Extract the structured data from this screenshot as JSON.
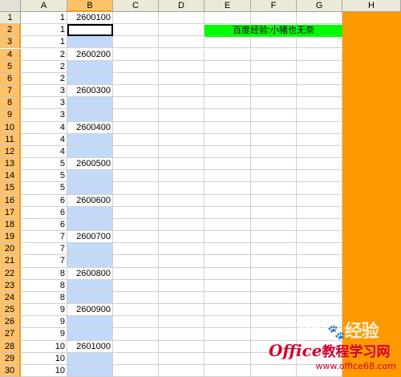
{
  "columns": [
    "A",
    "B",
    "C",
    "D",
    "E",
    "F",
    "G",
    "H"
  ],
  "selected_column": "B",
  "rows": [
    {
      "num": "1",
      "a": "1",
      "b": "2600100"
    },
    {
      "num": "2",
      "a": "1",
      "b": ""
    },
    {
      "num": "3",
      "a": "1",
      "b": ""
    },
    {
      "num": "4",
      "a": "2",
      "b": "2600200"
    },
    {
      "num": "5",
      "a": "2",
      "b": ""
    },
    {
      "num": "6",
      "a": "2",
      "b": ""
    },
    {
      "num": "7",
      "a": "3",
      "b": "2600300"
    },
    {
      "num": "8",
      "a": "3",
      "b": ""
    },
    {
      "num": "9",
      "a": "3",
      "b": ""
    },
    {
      "num": "10",
      "a": "4",
      "b": "2600400"
    },
    {
      "num": "11",
      "a": "4",
      "b": ""
    },
    {
      "num": "12",
      "a": "4",
      "b": ""
    },
    {
      "num": "13",
      "a": "5",
      "b": "2600500"
    },
    {
      "num": "14",
      "a": "5",
      "b": ""
    },
    {
      "num": "15",
      "a": "5",
      "b": ""
    },
    {
      "num": "16",
      "a": "6",
      "b": "2600600"
    },
    {
      "num": "17",
      "a": "6",
      "b": ""
    },
    {
      "num": "18",
      "a": "6",
      "b": ""
    },
    {
      "num": "19",
      "a": "7",
      "b": "2600700"
    },
    {
      "num": "20",
      "a": "7",
      "b": ""
    },
    {
      "num": "21",
      "a": "7",
      "b": ""
    },
    {
      "num": "22",
      "a": "8",
      "b": "2600800"
    },
    {
      "num": "23",
      "a": "8",
      "b": ""
    },
    {
      "num": "24",
      "a": "8",
      "b": ""
    },
    {
      "num": "25",
      "a": "9",
      "b": "2600900"
    },
    {
      "num": "26",
      "a": "9",
      "b": ""
    },
    {
      "num": "27",
      "a": "9",
      "b": ""
    },
    {
      "num": "28",
      "a": "10",
      "b": "2601000"
    },
    {
      "num": "29",
      "a": "10",
      "b": ""
    },
    {
      "num": "30",
      "a": "10",
      "b": ""
    }
  ],
  "active_cell": "B2",
  "green_label": "百度经验:小猪也无奈",
  "colors": {
    "selected_header": "#ffc26b",
    "selected_cells": "#c2daf7",
    "orange_column": "#ff9900",
    "green_label": "#00ff00",
    "logo_red": "#d3002d"
  },
  "watermark": {
    "baidu_text": "Bai",
    "paw": "🐾",
    "jingyan": "经验"
  },
  "site_logo": {
    "brand": "Office",
    "brand_cn": "教程学习网",
    "url": "www.office68.com"
  }
}
